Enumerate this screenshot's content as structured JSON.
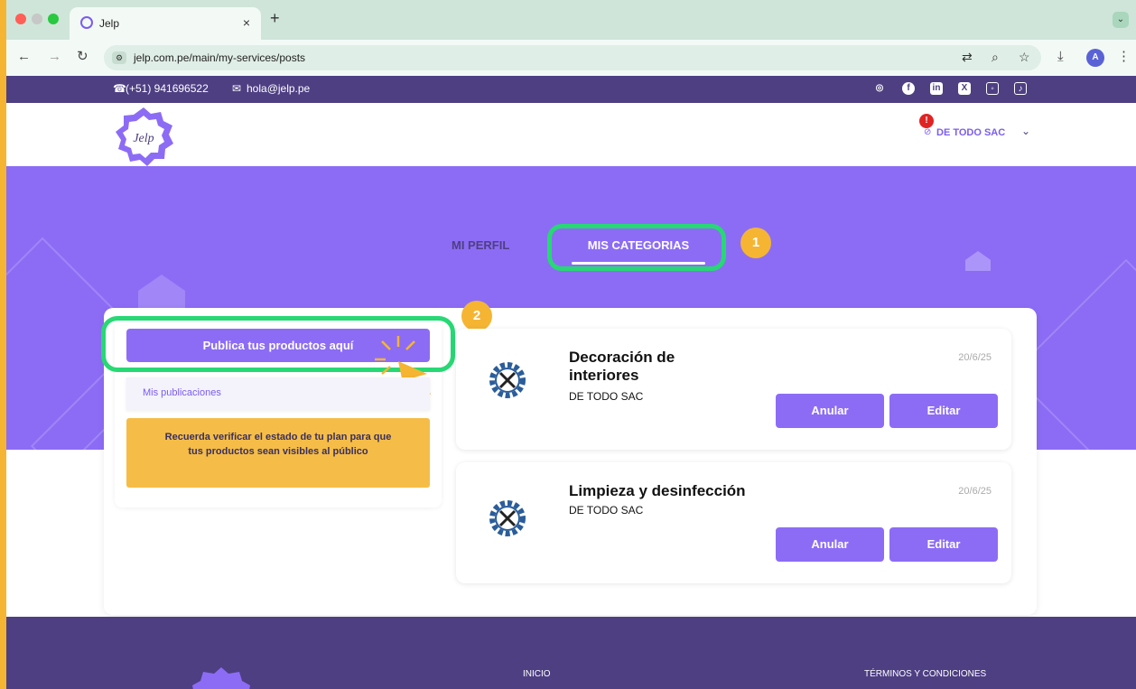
{
  "browser": {
    "tab_title": "Jelp",
    "tab_close": "×",
    "new_tab": "+",
    "url": "jelp.com.pe/main/my-services/posts",
    "avatar_letter": "A",
    "icons": [
      "back-icon",
      "forward-icon",
      "reload-icon",
      "site-settings-icon",
      "translate-icon",
      "zoom-icon",
      "star-icon",
      "download-icon",
      "menu-icon"
    ]
  },
  "topbar": {
    "phone": "(+51) 941696522",
    "email": "hola@jelp.pe",
    "social_icons": [
      "whatsapp-icon",
      "facebook-icon",
      "linkedin-icon",
      "x-icon",
      "instagram-icon",
      "tiktok-icon"
    ]
  },
  "header": {
    "logo_text": "Jelp",
    "company": "DE TODO SAC",
    "alert": "!"
  },
  "tabs": {
    "profile": "MI PERFIL",
    "categories": "MIS CATEGORIAS"
  },
  "steps": {
    "one": "1",
    "two": "2"
  },
  "sidebar": {
    "publish": "Publica tus productos aquí",
    "my_posts": "Mis publicaciones",
    "notice": "Recuerda verificar el estado de tu plan para que tus productos sean visibles al público"
  },
  "services": [
    {
      "title": "Decoración de interiores",
      "company": "DE TODO SAC",
      "date": "20/6/25",
      "cancel": "Anular",
      "edit": "Editar"
    },
    {
      "title": "Limpieza y desinfección",
      "company": "DE TODO SAC",
      "date": "20/6/25",
      "cancel": "Anular",
      "edit": "Editar"
    }
  ],
  "footer": {
    "home": "INICIO",
    "terms": "TÉRMINOS Y CONDICIONES"
  },
  "colors": {
    "accent": "#8c6cf5",
    "dark_purple": "#4e3f83",
    "highlight": "#27d874",
    "badge": "#f5b533"
  }
}
